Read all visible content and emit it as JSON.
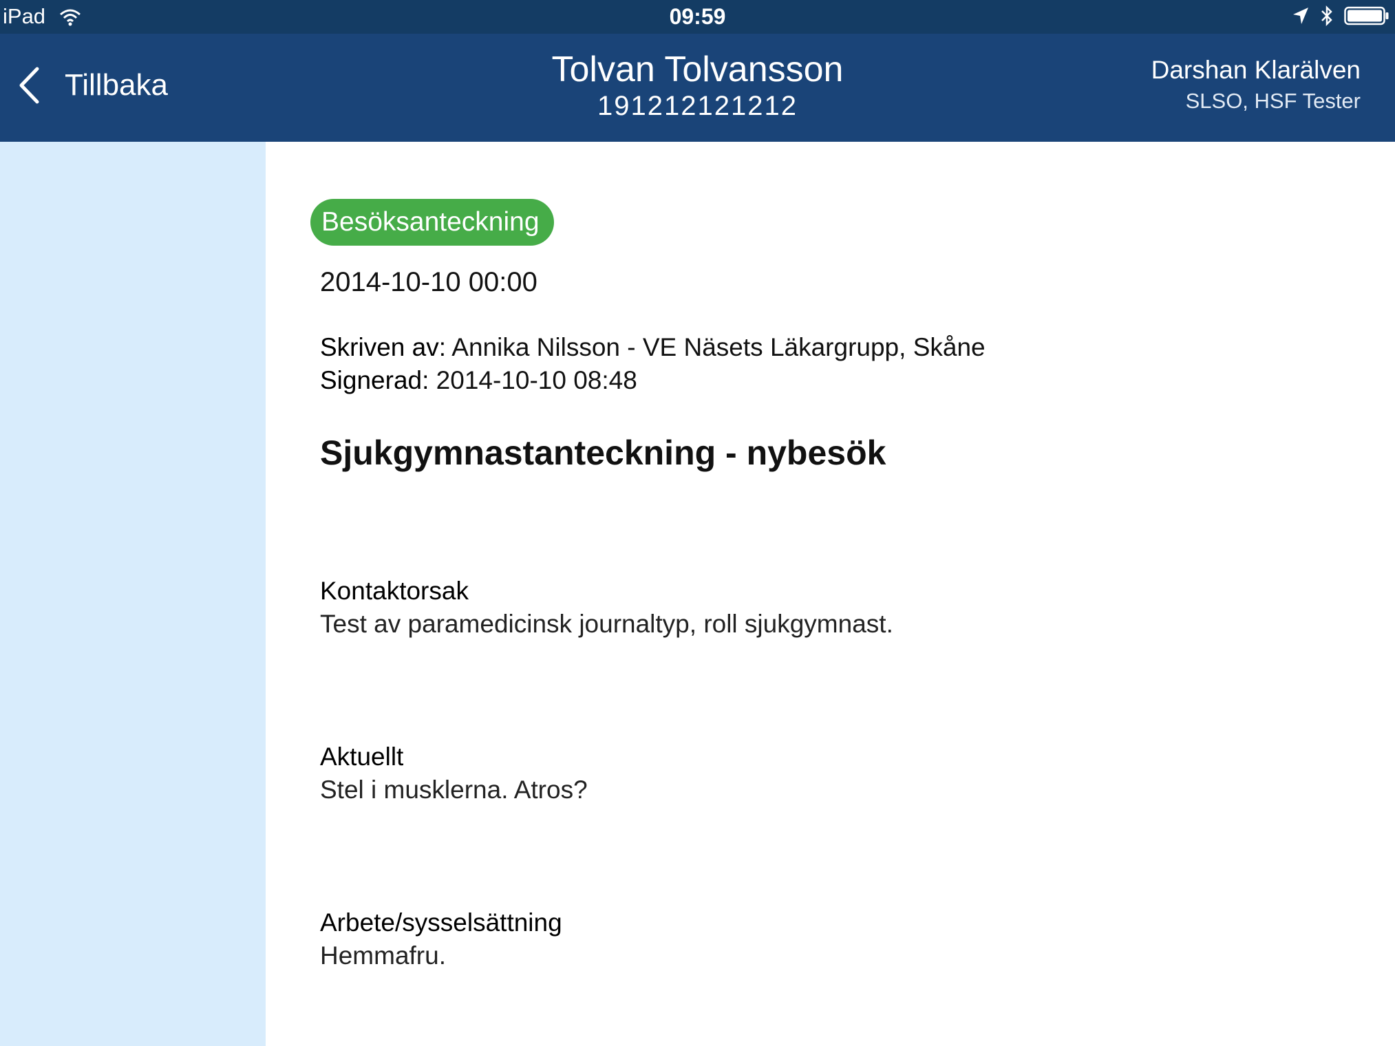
{
  "status_bar": {
    "device": "iPad",
    "time": "09:59"
  },
  "nav": {
    "back_label": "Tillbaka",
    "patient_name": "Tolvan Tolvansson",
    "patient_id": "191212121212",
    "user_name": "Darshan Klarälven",
    "user_org": "SLSO, HSF Tester"
  },
  "note": {
    "badge": "Besöksanteckning",
    "date": "2014-10-10 00:00",
    "written_by_label": "Skriven av:",
    "written_by_value": "Annika Nilsson - VE Näsets Läkargrupp, Skåne",
    "signed_label": "Signerad:",
    "signed_value": "2014-10-10 08:48",
    "title": "Sjukgymnastanteckning - nybesök",
    "sections": [
      {
        "heading": "Kontaktorsak",
        "text": "Test av paramedicinsk journaltyp, roll sjukgymnast."
      },
      {
        "heading": "Aktuellt",
        "text": "Stel i musklerna. Atros?"
      },
      {
        "heading": "Arbete/sysselsättning",
        "text": "Hemmafru."
      }
    ]
  },
  "colors": {
    "status_bar": "#143c64",
    "nav_bar": "#1a4478",
    "sidebar": "#d8ecfc",
    "badge": "#46ac48"
  }
}
